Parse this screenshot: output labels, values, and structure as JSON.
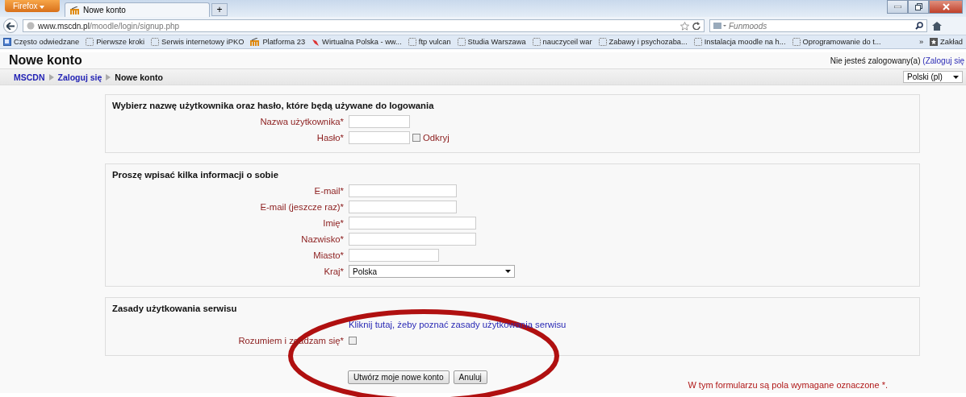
{
  "browser": {
    "menu_button": "Firefox",
    "tabs": [
      {
        "title": "Nowe konto",
        "selected": true
      }
    ],
    "new_tab": "+",
    "url_host": "www.mscdn.pl",
    "url_path": "/moodle/login/signup.php",
    "search_placeholder": "Funmoods",
    "bookmarks": [
      {
        "label": "Często odwiedzane",
        "kind": "frequent"
      },
      {
        "label": "Pierwsze kroki",
        "kind": "blank"
      },
      {
        "label": "Serwis internetowy iPKO",
        "kind": "blank"
      },
      {
        "label": "Platforma 23",
        "kind": "moodle"
      },
      {
        "label": "Wirtualna Polska - ww...",
        "kind": "site"
      },
      {
        "label": "ftp vulcan",
        "kind": "blank"
      },
      {
        "label": "Studia Warszawa",
        "kind": "blank"
      },
      {
        "label": "nauczyceil war",
        "kind": "blank"
      },
      {
        "label": "Zabawy i psychozaba...",
        "kind": "blank"
      },
      {
        "label": "Instalacja moodle na h...",
        "kind": "blank"
      },
      {
        "label": "Oprogramowanie do t...",
        "kind": "blank"
      }
    ],
    "bookmarks_more": "»",
    "bookmarks_menu": "Zakład"
  },
  "page": {
    "title": "Nowe konto",
    "login_status": "Nie jesteś zalogowany(a)",
    "login_link": "(Zaloguj się",
    "breadcrumb": [
      {
        "label": "MSCDN",
        "link": true
      },
      {
        "label": "Zaloguj się",
        "link": true
      },
      {
        "label": "Nowe konto",
        "link": false
      }
    ],
    "language": "Polski (pl)",
    "fieldsets": [
      {
        "legend": "Wybierz nazwę użytkownika oraz hasło, które będą używane do logowania",
        "rows": [
          {
            "kind": "text",
            "label": "Nazwa użytkownika*"
          },
          {
            "kind": "password",
            "label": "Hasło*",
            "option_label": "Odkryj",
            "checked": false
          }
        ]
      },
      {
        "legend": "Proszę wpisać kilka informacji o sobie",
        "rows": [
          {
            "kind": "text",
            "label": "E-mail*"
          },
          {
            "kind": "text",
            "label": "E-mail (jeszcze raz)*"
          },
          {
            "kind": "text",
            "label": "Imię*"
          },
          {
            "kind": "text",
            "label": "Nazwisko*"
          },
          {
            "kind": "text",
            "label": "Miasto*"
          },
          {
            "kind": "select",
            "label": "Kraj*",
            "value": "Polska"
          }
        ]
      },
      {
        "legend": "Zasady użytkowania serwisu",
        "rows": [
          {
            "kind": "link",
            "text": "Kliknij tutaj, żeby poznać zasady użytkowania serwisu"
          },
          {
            "kind": "checkbox",
            "label": "Rozumiem i zgadzam się*",
            "checked": false
          }
        ]
      }
    ],
    "buttons": [
      "Utwórz moje nowe konto",
      "Anuluj"
    ],
    "required_note": "W tym formularzu są pola wymagane oznaczone *."
  }
}
